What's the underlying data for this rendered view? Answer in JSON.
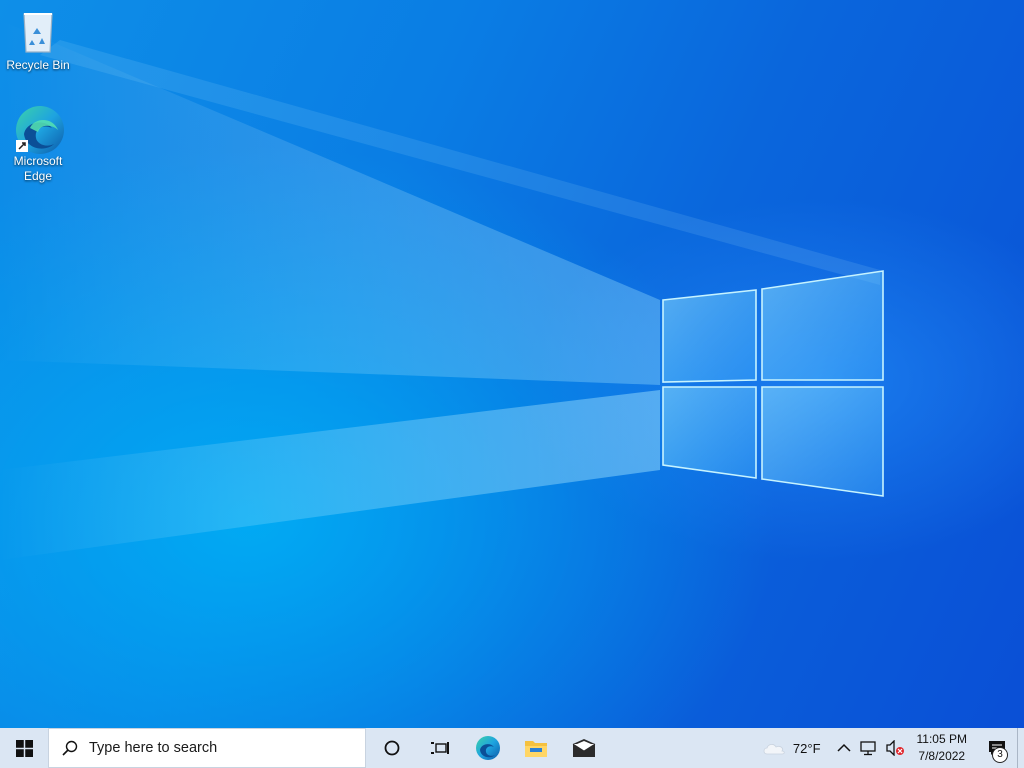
{
  "desktop": {
    "icons": [
      {
        "label": "Recycle Bin",
        "icon": "recycle-bin-icon"
      },
      {
        "label": "Microsoft Edge",
        "icon": "edge-icon"
      }
    ]
  },
  "taskbar": {
    "search": {
      "placeholder": "Type here to search"
    },
    "pinned": [
      {
        "name": "task-view",
        "icon": "cortana-circle-icon"
      },
      {
        "name": "task-view",
        "icon": "task-view-icon"
      },
      {
        "name": "edge",
        "icon": "edge-icon"
      },
      {
        "name": "file-explorer",
        "icon": "folder-icon"
      },
      {
        "name": "mail",
        "icon": "mail-icon"
      }
    ],
    "tray": {
      "weather": "72°F",
      "time": "11:05 PM",
      "date": "7/8/2022",
      "notification_count": "3"
    }
  },
  "colors": {
    "accent": "#0a78e0",
    "taskbar_bg": "#dbe6f3"
  }
}
